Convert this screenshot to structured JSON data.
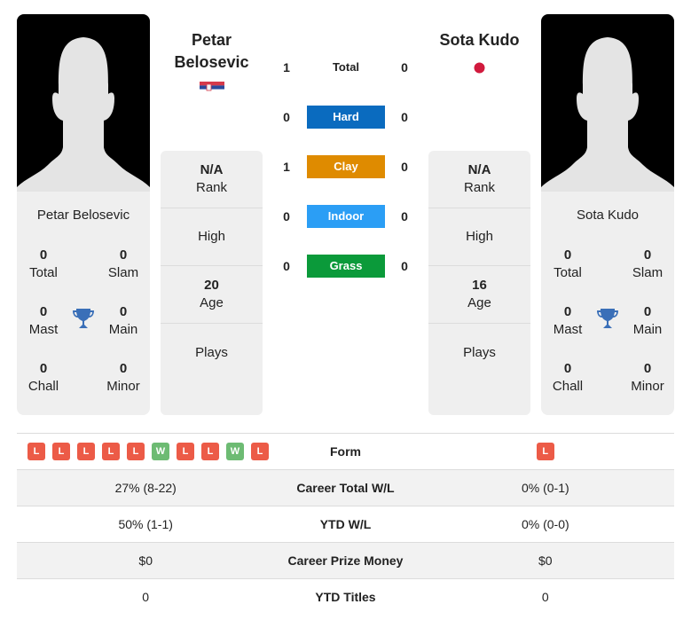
{
  "player1": {
    "name": "Petar Belosevic",
    "name_line1": "Petar",
    "name_line2": "Belosevic",
    "flag": "serbia-flag",
    "stats": {
      "total": {
        "value": "0",
        "label": "Total"
      },
      "slam": {
        "value": "0",
        "label": "Slam"
      },
      "mast": {
        "value": "0",
        "label": "Mast"
      },
      "main": {
        "value": "0",
        "label": "Main"
      },
      "chall": {
        "value": "0",
        "label": "Chall"
      },
      "minor": {
        "value": "0",
        "label": "Minor"
      }
    },
    "info": {
      "rank": {
        "value": "N/A",
        "label": "Rank"
      },
      "high": {
        "value": "",
        "label": "High"
      },
      "age": {
        "value": "20",
        "label": "Age"
      },
      "plays": {
        "value": "",
        "label": "Plays"
      }
    }
  },
  "player2": {
    "name": "Sota Kudo",
    "flag": "japan-flag",
    "stats": {
      "total": {
        "value": "0",
        "label": "Total"
      },
      "slam": {
        "value": "0",
        "label": "Slam"
      },
      "mast": {
        "value": "0",
        "label": "Mast"
      },
      "main": {
        "value": "0",
        "label": "Main"
      },
      "chall": {
        "value": "0",
        "label": "Chall"
      },
      "minor": {
        "value": "0",
        "label": "Minor"
      }
    },
    "info": {
      "rank": {
        "value": "N/A",
        "label": "Rank"
      },
      "high": {
        "value": "",
        "label": "High"
      },
      "age": {
        "value": "16",
        "label": "Age"
      },
      "plays": {
        "value": "",
        "label": "Plays"
      }
    }
  },
  "h2h": [
    {
      "label": "Total",
      "p1": "1",
      "p2": "0",
      "color": ""
    },
    {
      "label": "Hard",
      "p1": "0",
      "p2": "0",
      "color": "#0a6bbf"
    },
    {
      "label": "Clay",
      "p1": "1",
      "p2": "0",
      "color": "#df8b00"
    },
    {
      "label": "Indoor",
      "p1": "0",
      "p2": "0",
      "color": "#2b9ef5"
    },
    {
      "label": "Grass",
      "p1": "0",
      "p2": "0",
      "color": "#0b9a3a"
    }
  ],
  "comparison": {
    "form_label": "Form",
    "p1_form": [
      "L",
      "L",
      "L",
      "L",
      "L",
      "W",
      "L",
      "L",
      "W",
      "L"
    ],
    "p2_form": [
      "L"
    ],
    "rows": [
      {
        "label": "Career Total W/L",
        "p1": "27% (8-22)",
        "p2": "0% (0-1)"
      },
      {
        "label": "YTD W/L",
        "p1": "50% (1-1)",
        "p2": "0% (0-0)"
      },
      {
        "label": "Career Prize Money",
        "p1": "$0",
        "p2": "$0"
      },
      {
        "label": "YTD Titles",
        "p1": "0",
        "p2": "0"
      }
    ]
  },
  "colors": {
    "loss": "#ec5b47",
    "win": "#6dbb73",
    "trophy": "#3a6fb8",
    "japan_red": "#d11a3d"
  }
}
